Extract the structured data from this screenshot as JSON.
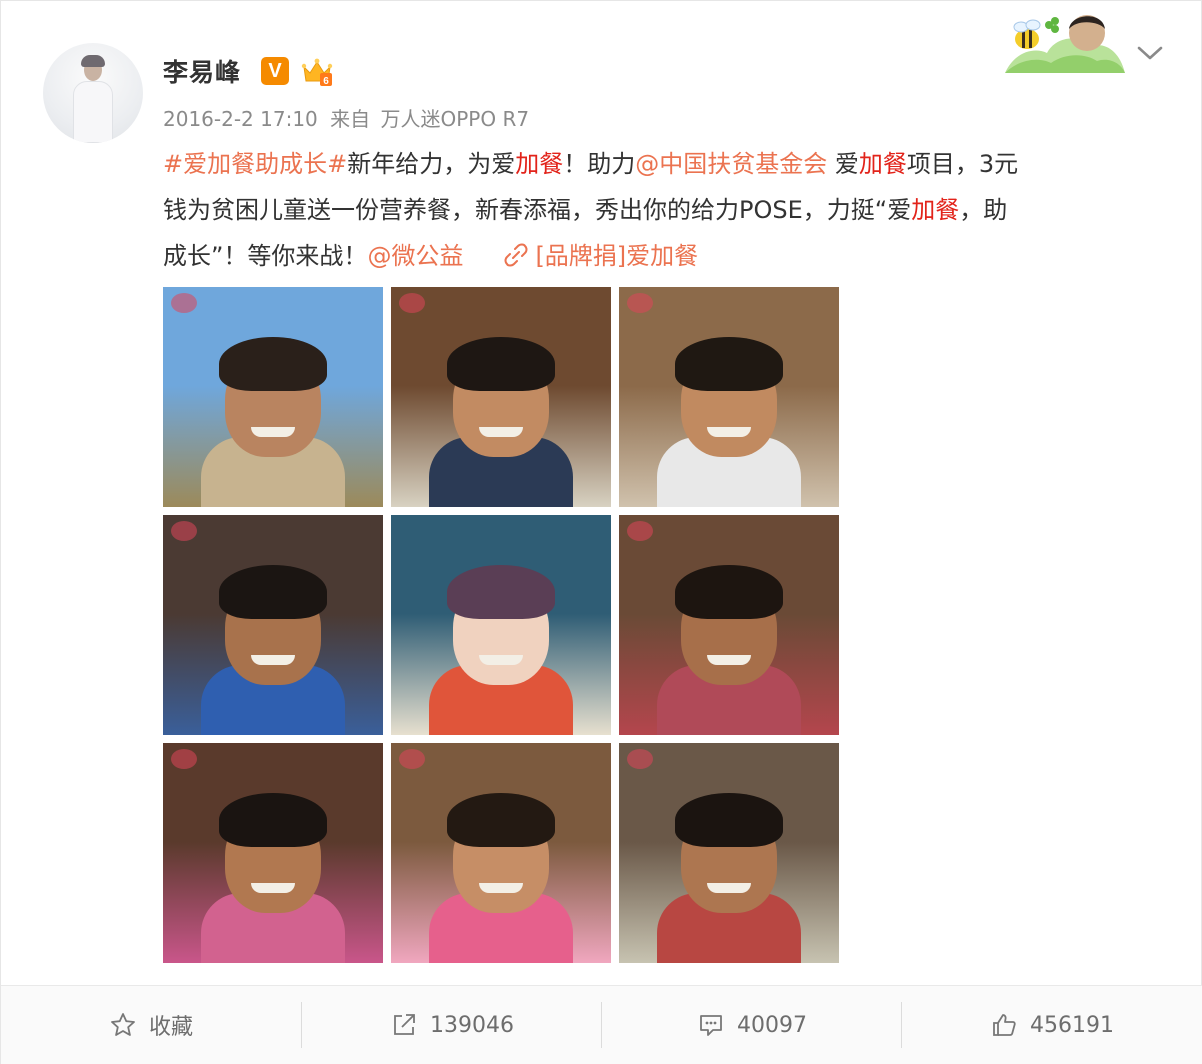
{
  "user": {
    "name": "李易峰",
    "verified_badge": "V",
    "timestamp": "2016-2-2 17:10",
    "source_prefix": "来自",
    "source": "万人迷OPPO R7"
  },
  "post": {
    "line1": [
      {
        "t": "#爱加餐助成长#",
        "k": "tag"
      },
      {
        "t": "新年给力，为爱",
        "k": "text"
      },
      {
        "t": "加餐",
        "k": "hl"
      },
      {
        "t": "！助力",
        "k": "text"
      },
      {
        "t": "@中国扶贫基金会",
        "k": "mention"
      },
      {
        "t": " 爱",
        "k": "text"
      },
      {
        "t": "加餐",
        "k": "hl"
      },
      {
        "t": "项目，3元",
        "k": "text"
      }
    ],
    "line2": [
      {
        "t": "钱为贫困儿童送一份营养餐，新春添福，秀出你的给力POSE，力挺“爱",
        "k": "text"
      },
      {
        "t": "加餐",
        "k": "hl"
      },
      {
        "t": "，助",
        "k": "text"
      }
    ],
    "line3": [
      {
        "t": "成长”！等你来战！",
        "k": "text"
      },
      {
        "t": "@微公益",
        "k": "mention"
      }
    ],
    "link_label": "[品牌捐]爱加餐"
  },
  "images": [
    {
      "name": "photo-boy-holding-milk",
      "sky": "#6fa7dc",
      "ground": "#9c8a5a",
      "skin": "#b98460",
      "hair": "#2a201a",
      "shirt": "#c7b38f"
    },
    {
      "name": "photo-girl-smiling-desk",
      "sky": "#6e4a30",
      "ground": "#d8d2c2",
      "skin": "#c28b62",
      "hair": "#1e1713",
      "shirt": "#2b3a55"
    },
    {
      "name": "photo-boy-classroom",
      "sky": "#8c6a4a",
      "ground": "#d0c2ad",
      "skin": "#c18a60",
      "hair": "#1f1812",
      "shirt": "#e8e8e8"
    },
    {
      "name": "photo-boy-with-bowl",
      "sky": "#4b3a33",
      "ground": "#3a5f9a",
      "skin": "#a8724c",
      "hair": "#1b1512",
      "shirt": "#2f5fb0"
    },
    {
      "name": "poster-ai-jia-can",
      "sky": "#2f5d75",
      "ground": "#e7e0cf",
      "skin": "#f0d2bf",
      "hair": "#5a3e55",
      "shirt": "#e0553a"
    },
    {
      "name": "photo-boy-peace-sign",
      "sky": "#6a4a36",
      "ground": "#b4464d",
      "skin": "#a76f4a",
      "hair": "#1d1510",
      "shirt": "#b04a58"
    },
    {
      "name": "photo-two-girls-heart",
      "sky": "#5a3a2c",
      "ground": "#c9568a",
      "skin": "#b17850",
      "hair": "#1a1411",
      "shirt": "#d2628f"
    },
    {
      "name": "photo-girl-with-book",
      "sky": "#7c5a3e",
      "ground": "#f0a7bf",
      "skin": "#c68e66",
      "hair": "#231912",
      "shirt": "#e6608c"
    },
    {
      "name": "photo-boy-with-book",
      "sky": "#6a5848",
      "ground": "#c7c3b1",
      "skin": "#ad7650",
      "hair": "#1b1410",
      "shirt": "#b84742"
    }
  ],
  "actions": {
    "favorite_label": "收藏",
    "repost_count": "139046",
    "comment_count": "40097",
    "like_count": "456191"
  },
  "colors": {
    "link": "#eb7350",
    "highlight": "#e2231a",
    "badge": "#f58a00"
  }
}
